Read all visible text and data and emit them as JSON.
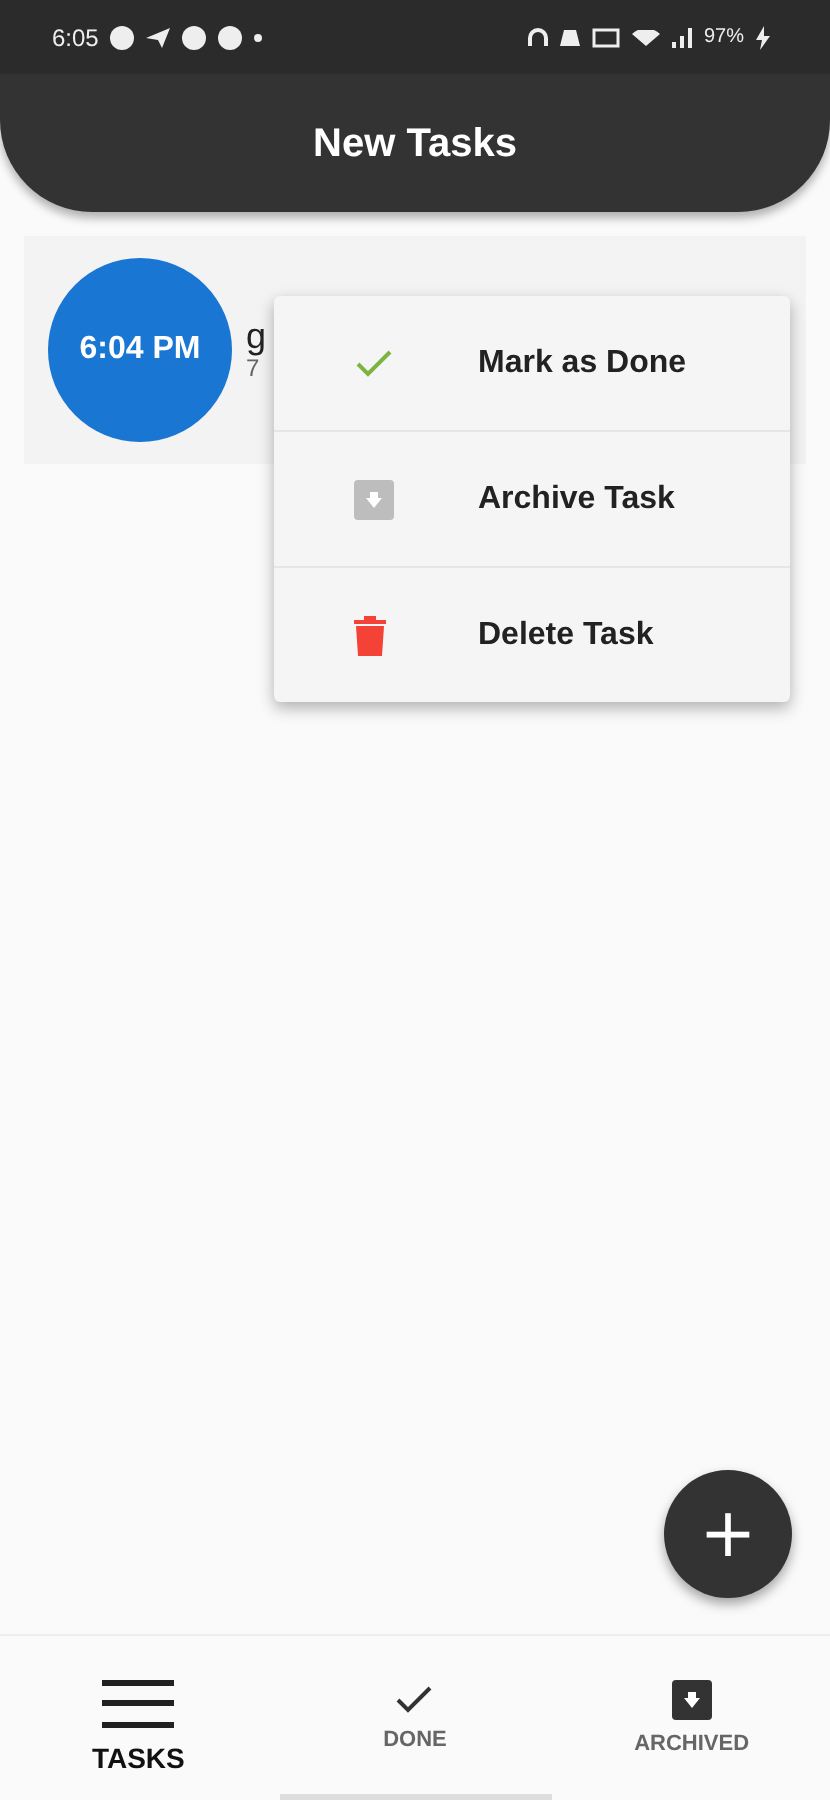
{
  "status_bar": {
    "time": "6:05",
    "battery": "97%"
  },
  "app_bar": {
    "title": "New Tasks"
  },
  "tasks": [
    {
      "time": "6:04 PM",
      "title": "g",
      "subtitle": "7"
    }
  ],
  "context_menu": [
    {
      "kind": "done",
      "label": "Mark as Done"
    },
    {
      "kind": "archive",
      "label": "Archive Task"
    },
    {
      "kind": "delete",
      "label": "Delete Task"
    }
  ],
  "fab": {
    "label": "+"
  },
  "bottom_nav": [
    {
      "kind": "tasks",
      "label": "TASKS",
      "selected": true
    },
    {
      "kind": "done",
      "label": "DONE",
      "selected": false
    },
    {
      "kind": "archived",
      "label": "ARCHIVED",
      "selected": false
    }
  ]
}
